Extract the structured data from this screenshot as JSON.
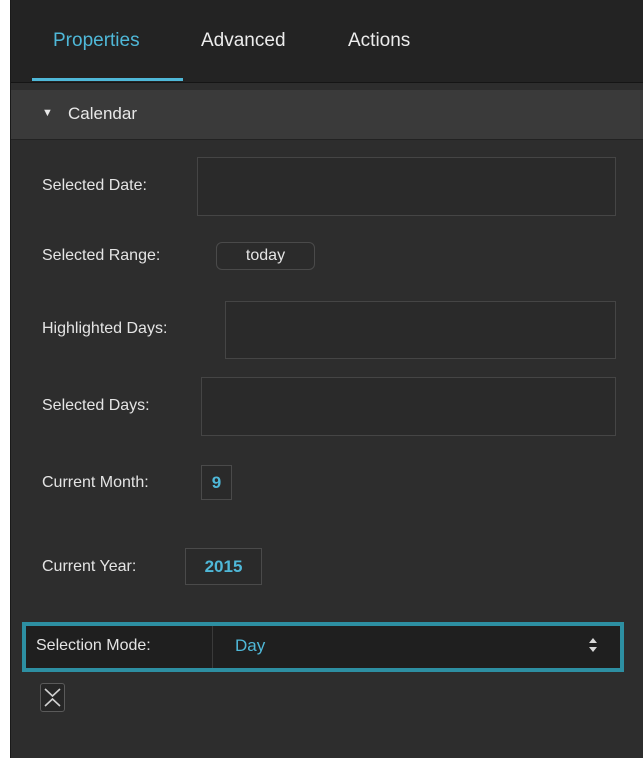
{
  "tabs": {
    "properties": "Properties",
    "advanced": "Advanced",
    "actions": "Actions"
  },
  "section": {
    "title": "Calendar"
  },
  "fields": {
    "selected_date": {
      "label": "Selected Date:",
      "value": ""
    },
    "selected_range": {
      "label": "Selected Range:",
      "value": "today"
    },
    "highlighted_days": {
      "label": "Highlighted Days:",
      "value": ""
    },
    "selected_days": {
      "label": "Selected Days:",
      "value": ""
    },
    "current_month": {
      "label": "Current Month:",
      "value": "9"
    },
    "current_year": {
      "label": "Current Year:",
      "value": "2015"
    },
    "selection_mode": {
      "label": "Selection Mode:",
      "value": "Day"
    }
  },
  "icons": {
    "section_toggle": "triangle-down-icon",
    "select_arrows": "up-down-arrows-icon",
    "collapse": "collapse-chevrons-icon"
  },
  "colors": {
    "accent": "#4fb8d8",
    "highlight_border": "#2d8fa2",
    "panel_bg": "#2d2d2d"
  }
}
